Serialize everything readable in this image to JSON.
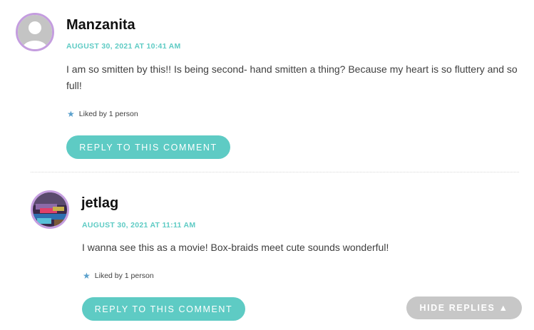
{
  "comments": [
    {
      "author": "Manzanita",
      "date": "AUGUST 30, 2021 AT 10:41 AM",
      "text": "I am so smitten by this!! Is being second- hand smitten a thing? Because my heart is so fluttery and so full!",
      "likes": "Liked by 1 person",
      "reply_label": "REPLY TO THIS COMMENT",
      "avatar_icon": "default-user-icon"
    },
    {
      "author": "jetlag",
      "date": "AUGUST 30, 2021 AT 11:11 AM",
      "text": "I wanna see this as a movie! Box-braids meet cute sounds wonderful!",
      "likes": "Liked by 1 person",
      "reply_label": "REPLY TO THIS COMMENT",
      "avatar_icon": "user-photo"
    }
  ],
  "hide_replies": {
    "label": "HIDE REPLIES",
    "icon": "▲"
  },
  "colors": {
    "accent": "#5ecbc4",
    "avatar_ring": "#c49ddf",
    "star": "#5aa0cc",
    "hide_button": "#c7c7c7"
  }
}
